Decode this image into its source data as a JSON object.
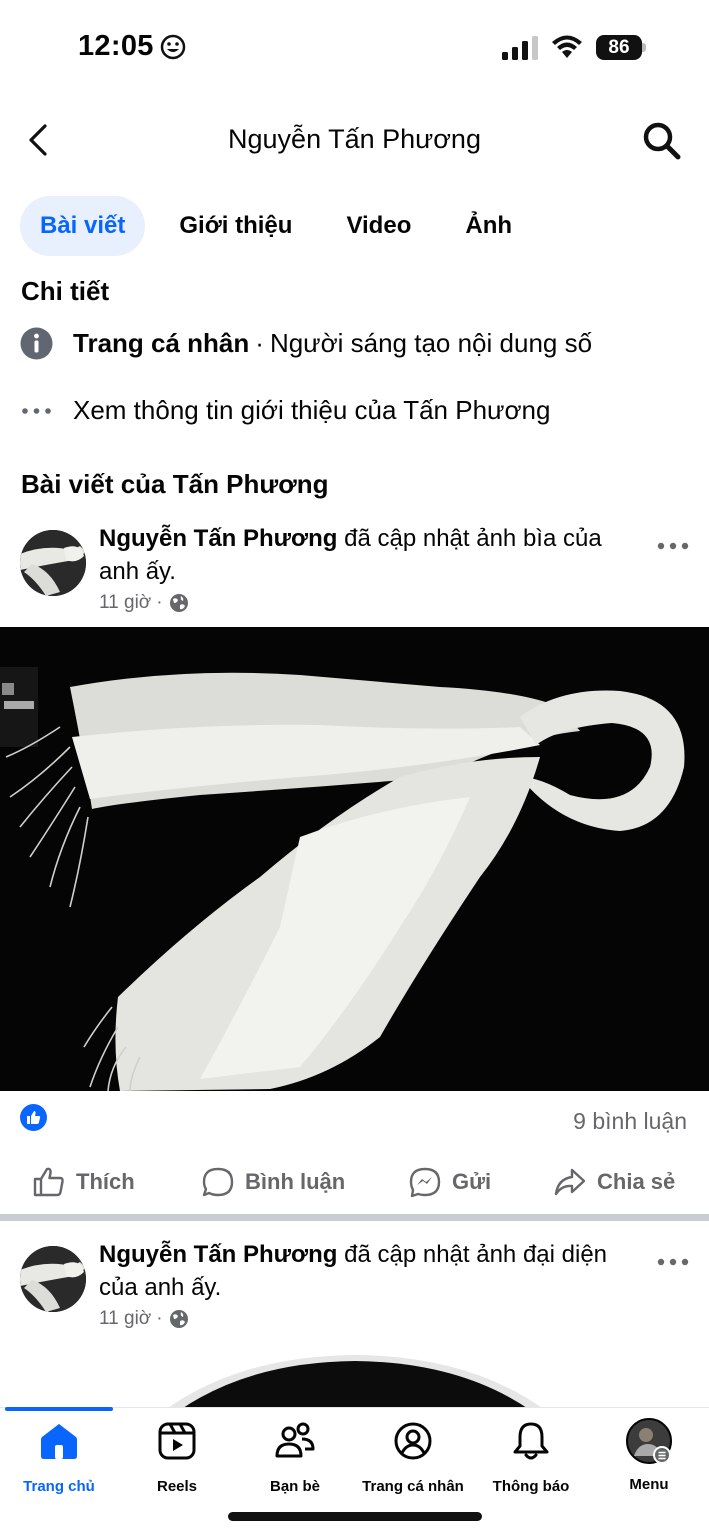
{
  "status_bar": {
    "time": "12:05",
    "battery": "86",
    "emoji_icon": "smiley-face-icon",
    "signal_icon": "cellular-signal-icon",
    "wifi_icon": "wifi-icon"
  },
  "header": {
    "title": "Nguyễn Tấn Phương",
    "back_icon": "chevron-left-icon",
    "search_icon": "search-icon"
  },
  "tabs": [
    {
      "label": "Bài viết",
      "active": true
    },
    {
      "label": "Giới thiệu",
      "active": false
    },
    {
      "label": "Video",
      "active": false
    },
    {
      "label": "Ảnh",
      "active": false
    }
  ],
  "details": {
    "title": "Chi tiết",
    "profile_type_label": "Trang cá nhân",
    "profile_type_separator": "·",
    "profile_type_value": "Người sáng tạo nội dung số",
    "see_about": "Xem thông tin giới thiệu của Tấn Phương"
  },
  "posts_section": {
    "title": "Bài viết của Tấn Phương"
  },
  "posts": [
    {
      "author": "Nguyễn Tấn Phương",
      "action": " đã cập nhật ảnh bìa của anh ấy.",
      "time": "11 giờ",
      "dot": "·",
      "audience_icon": "globe-icon",
      "comment_count": "9 bình luận",
      "actions": {
        "like": "Thích",
        "comment": "Bình luận",
        "send": "Gửi",
        "share": "Chia sẻ"
      }
    },
    {
      "author": "Nguyễn Tấn Phương",
      "action": " đã cập nhật ảnh đại diện của anh ấy.",
      "time": "11 giờ",
      "dot": "·",
      "audience_icon": "globe-icon"
    }
  ],
  "bottom_nav": [
    {
      "label": "Trang chủ",
      "icon": "home-icon",
      "active": true
    },
    {
      "label": "Reels",
      "icon": "reels-icon",
      "active": false
    },
    {
      "label": "Bạn bè",
      "icon": "friends-icon",
      "active": false
    },
    {
      "label": "Trang cá nhân",
      "icon": "profile-icon",
      "active": false
    },
    {
      "label": "Thông báo",
      "icon": "bell-icon",
      "active": false
    },
    {
      "label": "Menu",
      "icon": "menu-avatar-icon",
      "active": false
    }
  ],
  "colors": {
    "accent": "#0866ff",
    "active_tab_bg": "#e7f0fc",
    "secondary_text": "#65676b",
    "divider": "#c9ccd1"
  }
}
